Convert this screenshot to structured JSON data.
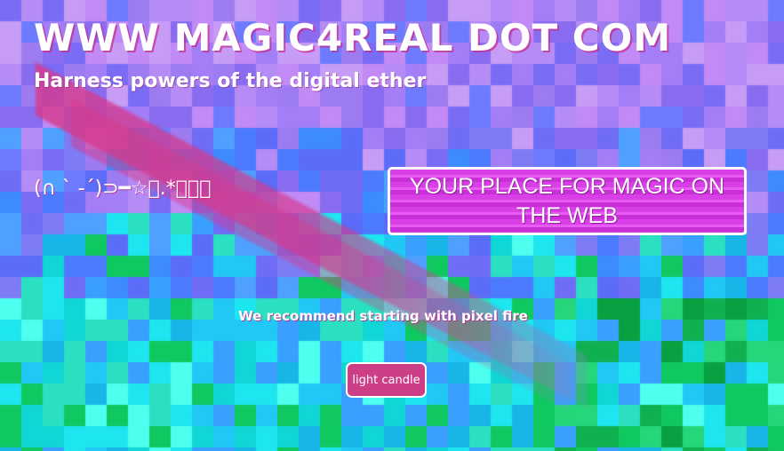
{
  "header": {
    "title": "WWW MAGIC4REAL DOT COM",
    "subtitle": "Harness powers of the digital ether"
  },
  "decor": {
    "kaomoji": "(∩ ` -´)⊃━☆ﾟ.*･｡ﾟ"
  },
  "banner": {
    "text": "YOUR PLACE FOR MAGIC ON THE WEB"
  },
  "main": {
    "recommend_text": "We recommend starting with pixel fire",
    "candle_button_label": "light candle"
  },
  "colors": {
    "accent_pink": "#cc3f86",
    "banner_magenta": "#d93fe6",
    "mosaic_purple": "#9d7cf2",
    "mosaic_blue": "#4d7bff",
    "mosaic_cyan": "#1ee6f0",
    "mosaic_green": "#10c860"
  }
}
